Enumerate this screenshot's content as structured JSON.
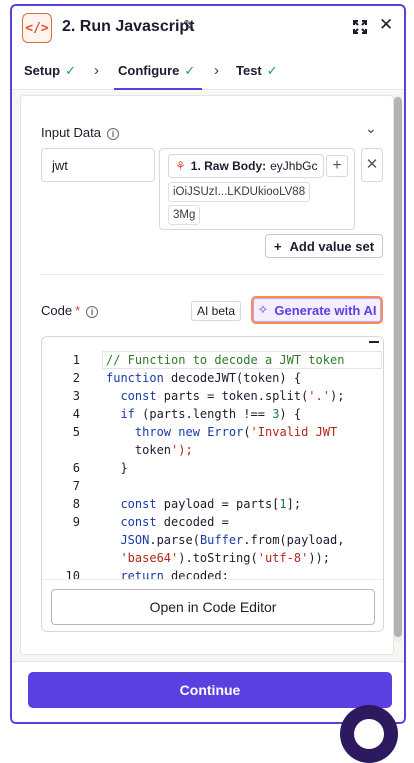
{
  "header": {
    "title": "2. Run Javascript",
    "app_icon": "</>",
    "icons": [
      "code-icon",
      "pencil-icon",
      "expand-icon",
      "close-icon"
    ]
  },
  "tabs": [
    {
      "label": "Setup",
      "done": true
    },
    {
      "label": "Configure",
      "done": true,
      "active": true
    },
    {
      "label": "Test",
      "done": true
    }
  ],
  "input_data": {
    "label": "Input Data",
    "key": "jwt",
    "value_pill_label": "1. Raw Body:",
    "value_pill_value": "eyJhbGc",
    "value_chunk_1": "iOiJSUzI...LKDUkiooLV88",
    "value_chunk_2": "3Mg",
    "add_value_set": "Add value set"
  },
  "code": {
    "label": "Code",
    "required_mark": "*",
    "ai_beta": "AI beta",
    "generate_ai": "Generate with AI",
    "open_editor": "Open in Code Editor"
  },
  "code_lines": [
    {
      "n": "1",
      "text": "// Function to decode a JWT token"
    },
    {
      "n": "2",
      "text": "function decodeJWT(token) {"
    },
    {
      "n": "3",
      "text": "  const parts = token.split('.');"
    },
    {
      "n": "4",
      "text": "  if (parts.length !== 3) {"
    },
    {
      "n": "5",
      "text": "    throw new Error('Invalid JWT"
    },
    {
      "n": "",
      "text": "    token');"
    },
    {
      "n": "6",
      "text": "  }"
    },
    {
      "n": "7",
      "text": ""
    },
    {
      "n": "8",
      "text": "  const payload = parts[1];"
    },
    {
      "n": "9",
      "text": "  const decoded ="
    },
    {
      "n": "",
      "text": "  JSON.parse(Buffer.from(payload,"
    },
    {
      "n": "",
      "text": "  'base64').toString('utf-8'));"
    },
    {
      "n": "10",
      "text": "  return decoded;"
    }
  ],
  "footer": {
    "continue": "Continue"
  },
  "colors": {
    "accent": "#5b3fe0",
    "success": "#1e9e5a",
    "brand_orange": "#e0522a"
  }
}
